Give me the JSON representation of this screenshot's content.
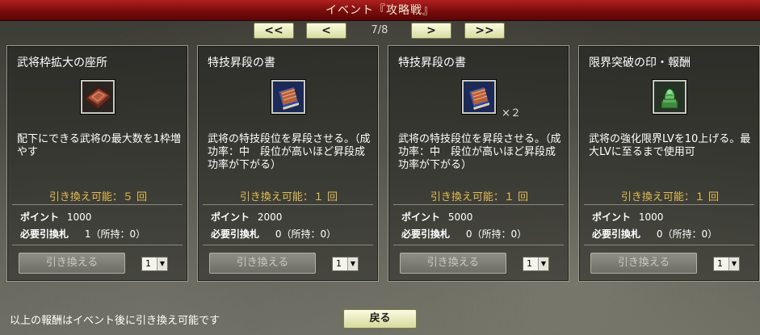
{
  "window": {
    "title": "イベント『攻略戦』"
  },
  "pager": {
    "first": "<<",
    "prev": "<",
    "page": "7/8",
    "next": ">",
    "last": ">>"
  },
  "cards": [
    {
      "title": "武将枠拡大の座所",
      "icon": "red-cushion-icon",
      "qty": "",
      "desc": "配下にできる武将の最大数を1枠増やす",
      "exchangeable": "引き換え可能：５ 回",
      "points_label": "ポイント",
      "points": "1000",
      "ticket_label": "必要引換札",
      "ticket": "1（所持：0）",
      "button": "引き換える",
      "select": "1"
    },
    {
      "title": "特技昇段の書",
      "icon": "blue-book-icon",
      "qty": "",
      "desc": "武将の特技段位を昇段させる。（成功率：中　段位が高いほど昇段成功率が下がる）",
      "exchangeable": "引き換え可能：１ 回",
      "points_label": "ポイント",
      "points": "2000",
      "ticket_label": "必要引換札",
      "ticket": "0（所持：0）",
      "button": "引き換える",
      "select": "1"
    },
    {
      "title": "特技昇段の書",
      "icon": "blue-book-icon",
      "qty": "×２",
      "desc": "武将の特技段位を昇段させる。（成功率：中　段位が高いほど昇段成功率が下がる）",
      "exchangeable": "引き換え可能：１ 回",
      "points_label": "ポイント",
      "points": "5000",
      "ticket_label": "必要引換札",
      "ticket": "0（所持：0）",
      "button": "引き換える",
      "select": "1"
    },
    {
      "title": "限界突破の印・報酬",
      "icon": "jade-seal-icon",
      "qty": "",
      "desc": "武将の強化限界LVを10上げる。最大LVに至るまで使用可",
      "exchangeable": "引き換え可能：１ 回",
      "points_label": "ポイント",
      "points": "1000",
      "ticket_label": "必要引換札",
      "ticket": "0（所持：0）",
      "button": "引き換える",
      "select": "1"
    }
  ],
  "footer": {
    "note": "以上の報酬はイベント後に引き換え可能です",
    "back": "戻る"
  },
  "colors": {
    "titlebar": "#8a1010",
    "exchangeable_text": "#e2bd52",
    "button_cream": "#e8ebbb",
    "button_disabled": "#7e7e76"
  }
}
